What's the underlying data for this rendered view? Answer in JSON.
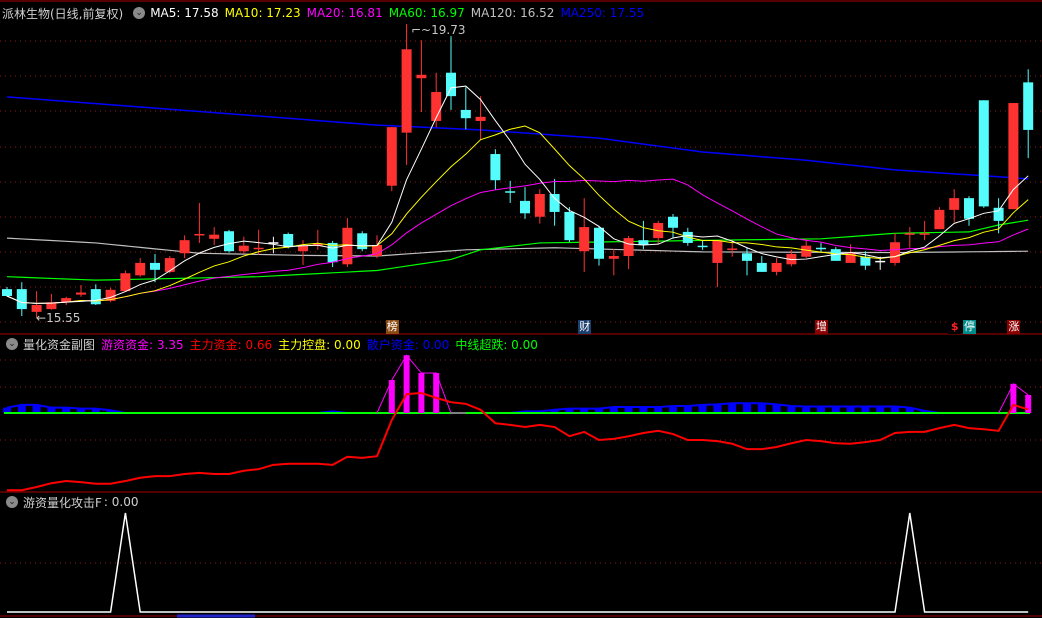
{
  "main": {
    "title": "派林生物(日线,前复权)",
    "ma": [
      {
        "label": "MA5: 17.58",
        "color": "#ffffff"
      },
      {
        "label": "MA10: 17.23",
        "color": "#ffff00"
      },
      {
        "label": "MA20: 16.81",
        "color": "#ff00ff"
      },
      {
        "label": "MA60: 16.97",
        "color": "#00ff00"
      },
      {
        "label": "MA120: 16.52",
        "color": "#c0c0c0"
      },
      {
        "label": "MA250: 17.55",
        "color": "#0000ff"
      }
    ],
    "high_label": "19.73",
    "low_label": "15.55",
    "markers": [
      {
        "text": "榜",
        "index": 26,
        "color": "#8b4a12"
      },
      {
        "text": "财",
        "index": 39,
        "color": "#1c3f6e"
      },
      {
        "text": "增",
        "index": 55,
        "color": "#8b0000"
      },
      {
        "text": "$",
        "index": 64,
        "color": "#000000"
      },
      {
        "text": "停",
        "index": 65,
        "color": "#008b8b"
      },
      {
        "text": "涨",
        "index": 68,
        "color": "#8b0000"
      }
    ]
  },
  "sub1": {
    "title": "量化资金副图",
    "items": [
      {
        "label": "游资资金: 3.35",
        "color": "#ff00ff"
      },
      {
        "label": "主力资金: 0.66",
        "color": "#ff0000"
      },
      {
        "label": "主力控盘: 0.00",
        "color": "#ffff00"
      },
      {
        "label": "散户资金: 0.00",
        "color": "#0000ff"
      },
      {
        "label": "中线超跌: 0.00",
        "color": "#00ff00"
      }
    ]
  },
  "sub2": {
    "title": "游资量化攻击F",
    "value": ": 0.00"
  },
  "chart_data": {
    "type": "candlestick",
    "candles": [
      [
        15.97,
        16.0,
        15.86,
        15.87
      ],
      [
        15.97,
        16.07,
        15.58,
        15.68
      ],
      [
        15.64,
        15.94,
        15.55,
        15.74
      ],
      [
        15.68,
        15.9,
        15.67,
        15.78
      ],
      [
        15.78,
        15.86,
        15.74,
        15.84
      ],
      [
        15.89,
        16.03,
        15.86,
        15.92
      ],
      [
        15.97,
        16.04,
        15.74,
        15.75
      ],
      [
        15.8,
        15.99,
        15.78,
        15.96
      ],
      [
        15.94,
        16.24,
        15.93,
        16.2
      ],
      [
        16.17,
        16.42,
        16.15,
        16.35
      ],
      [
        16.35,
        16.48,
        16.07,
        16.25
      ],
      [
        16.22,
        16.45,
        16.2,
        16.42
      ],
      [
        16.49,
        16.75,
        16.42,
        16.68
      ],
      [
        16.76,
        17.22,
        16.64,
        16.77
      ],
      [
        16.7,
        16.87,
        16.61,
        16.76
      ],
      [
        16.81,
        16.83,
        16.5,
        16.52
      ],
      [
        16.52,
        16.73,
        16.48,
        16.6
      ],
      [
        16.56,
        16.83,
        16.47,
        16.57
      ],
      [
        16.65,
        16.73,
        16.49,
        16.65
      ],
      [
        16.77,
        16.79,
        16.56,
        16.58
      ],
      [
        16.52,
        16.68,
        16.32,
        16.6
      ],
      [
        16.6,
        16.83,
        16.54,
        16.63
      ],
      [
        16.64,
        16.67,
        16.29,
        16.36
      ],
      [
        16.33,
        17.0,
        16.29,
        16.86
      ],
      [
        16.78,
        16.81,
        16.52,
        16.55
      ],
      [
        16.45,
        16.75,
        16.42,
        16.61
      ],
      [
        17.47,
        18.32,
        17.39,
        18.32
      ],
      [
        18.24,
        19.73,
        17.77,
        19.45
      ],
      [
        19.03,
        19.58,
        18.54,
        19.08
      ],
      [
        18.41,
        19.11,
        18.32,
        18.83
      ],
      [
        19.11,
        19.64,
        18.57,
        18.77
      ],
      [
        18.57,
        18.9,
        18.29,
        18.45
      ],
      [
        18.41,
        18.77,
        18.13,
        18.47
      ],
      [
        17.93,
        18.0,
        17.41,
        17.55
      ],
      [
        17.39,
        17.54,
        17.22,
        17.37
      ],
      [
        17.25,
        17.45,
        16.99,
        17.07
      ],
      [
        17.02,
        17.42,
        16.92,
        17.35
      ],
      [
        17.35,
        17.57,
        16.89,
        17.09
      ],
      [
        17.09,
        17.16,
        16.65,
        16.68
      ],
      [
        16.52,
        17.29,
        16.22,
        16.87
      ],
      [
        16.86,
        16.89,
        16.31,
        16.41
      ],
      [
        16.41,
        16.55,
        16.17,
        16.45
      ],
      [
        16.45,
        16.74,
        16.26,
        16.71
      ],
      [
        16.68,
        16.96,
        16.55,
        16.61
      ],
      [
        16.71,
        16.96,
        16.62,
        16.93
      ],
      [
        17.02,
        17.06,
        16.71,
        16.86
      ],
      [
        16.8,
        16.86,
        16.6,
        16.64
      ],
      [
        16.6,
        16.68,
        16.54,
        16.59
      ],
      [
        16.35,
        16.68,
        16.0,
        16.68
      ],
      [
        16.55,
        16.68,
        16.44,
        16.56
      ],
      [
        16.49,
        16.57,
        16.17,
        16.38
      ],
      [
        16.35,
        16.45,
        16.22,
        16.22
      ],
      [
        16.22,
        16.42,
        16.17,
        16.35
      ],
      [
        16.33,
        16.54,
        16.3,
        16.48
      ],
      [
        16.44,
        16.7,
        16.42,
        16.6
      ],
      [
        16.57,
        16.64,
        16.51,
        16.56
      ],
      [
        16.55,
        16.58,
        16.38,
        16.38
      ],
      [
        16.35,
        16.62,
        16.35,
        16.49
      ],
      [
        16.44,
        16.52,
        16.25,
        16.31
      ],
      [
        16.38,
        16.44,
        16.25,
        16.38
      ],
      [
        16.35,
        16.78,
        16.31,
        16.65
      ],
      [
        16.77,
        16.87,
        16.57,
        16.78
      ],
      [
        16.77,
        16.96,
        16.68,
        16.78
      ],
      [
        16.84,
        17.16,
        16.84,
        17.12
      ],
      [
        17.12,
        17.42,
        16.94,
        17.29
      ],
      [
        17.29,
        17.32,
        16.89,
        16.99
      ],
      [
        18.71,
        18.71,
        17.15,
        17.17
      ],
      [
        17.15,
        17.29,
        16.78,
        16.96
      ],
      [
        17.13,
        18.67,
        17.13,
        18.67
      ],
      [
        18.97,
        19.16,
        17.87,
        18.28
      ]
    ],
    "ma60": [
      [
        0,
        16.15
      ],
      [
        6,
        16.1
      ],
      [
        17,
        16.15
      ],
      [
        25,
        16.24
      ],
      [
        30,
        16.4
      ],
      [
        32,
        16.54
      ],
      [
        36,
        16.64
      ],
      [
        48,
        16.68
      ],
      [
        55,
        16.7
      ],
      [
        60,
        16.78
      ],
      [
        65,
        16.8
      ],
      [
        67,
        16.9
      ],
      [
        69,
        16.97
      ]
    ],
    "ma120": [
      [
        0,
        16.71
      ],
      [
        6,
        16.64
      ],
      [
        13,
        16.49
      ],
      [
        20,
        16.46
      ],
      [
        25,
        16.45
      ],
      [
        31,
        16.54
      ],
      [
        37,
        16.57
      ],
      [
        47,
        16.51
      ],
      [
        60,
        16.5
      ],
      [
        69,
        16.52
      ]
    ],
    "ma250": [
      [
        0,
        18.76
      ],
      [
        25,
        18.35
      ],
      [
        32,
        18.28
      ],
      [
        40,
        18.16
      ],
      [
        47,
        17.96
      ],
      [
        54,
        17.84
      ],
      [
        60,
        17.7
      ],
      [
        67,
        17.6
      ],
      [
        69,
        17.57
      ]
    ],
    "sub1_main": [
      -14.3,
      -14.3,
      -13.7,
      -13.0,
      -12.6,
      -12.8,
      -13.1,
      -13.1,
      -12.6,
      -12.0,
      -11.7,
      -11.7,
      -11.3,
      -11.1,
      -11.3,
      -11.3,
      -10.7,
      -10.4,
      -9.6,
      -9.4,
      -9.4,
      -9.4,
      -9.6,
      -8.1,
      -8.3,
      -8.0,
      -1.3,
      3.5,
      3.7,
      2.8,
      2.0,
      1.7,
      0.6,
      -1.9,
      -2.2,
      -2.6,
      -2.2,
      -2.6,
      -4.3,
      -3.5,
      -5.0,
      -4.8,
      -4.3,
      -3.7,
      -3.3,
      -3.9,
      -5.0,
      -5.0,
      -5.2,
      -5.7,
      -6.7,
      -6.7,
      -6.3,
      -5.6,
      -5.0,
      -5.2,
      -5.6,
      -5.7,
      -5.4,
      -5.0,
      -3.7,
      -3.5,
      -3.5,
      -2.8,
      -2.2,
      -2.8,
      -3.0,
      -3.3,
      1.5,
      0.66
    ],
    "sub1_hot": [
      0,
      0,
      0,
      0,
      0,
      0,
      0,
      0,
      0,
      0,
      0,
      0,
      0,
      0,
      0,
      0,
      0,
      0,
      0,
      0,
      0,
      0,
      0,
      0,
      0,
      0,
      6.1,
      10.7,
      7.4,
      7.4,
      0,
      0,
      0,
      0,
      0,
      0,
      0,
      0,
      0,
      0,
      0,
      0,
      0,
      0,
      0,
      0,
      0,
      0,
      0,
      0,
      0,
      0,
      0,
      0,
      0,
      0,
      0,
      0,
      0,
      0,
      0,
      0,
      0,
      0,
      0,
      0,
      0,
      0,
      5.4,
      3.35
    ],
    "sub1_retail": [
      1.0,
      1.5,
      1.5,
      1.0,
      1.0,
      0.8,
      0.8,
      0.5,
      0,
      0,
      0,
      0,
      0,
      0,
      0,
      0,
      0,
      0,
      0,
      0,
      0,
      0,
      0.3,
      0,
      0,
      0,
      0,
      0,
      0,
      0,
      0,
      0,
      0,
      0,
      0,
      0.3,
      0.3,
      0.6,
      0.8,
      0.8,
      0.8,
      1.1,
      1.1,
      1.1,
      1.1,
      1.3,
      1.3,
      1.5,
      1.6,
      1.8,
      1.8,
      1.8,
      1.6,
      1.3,
      1.2,
      1.2,
      1.2,
      1.2,
      1.2,
      1.2,
      1.2,
      1.0,
      0.4,
      0,
      0,
      0,
      0,
      0,
      0,
      0
    ],
    "sub2_signal": [
      0,
      0,
      0,
      0,
      0,
      0,
      0,
      0,
      1,
      0,
      0,
      0,
      0,
      0,
      0,
      0,
      0,
      0,
      0,
      0,
      0,
      0,
      0,
      0,
      0,
      0,
      0,
      0,
      0,
      0,
      0,
      0,
      0,
      0,
      0,
      0,
      0,
      0,
      0,
      0,
      0,
      0,
      0,
      0,
      0,
      0,
      0,
      0,
      0,
      0,
      0,
      0,
      0,
      0,
      0,
      0,
      0,
      0,
      0,
      0,
      0,
      1,
      0,
      0,
      0,
      0,
      0,
      0,
      0,
      0
    ]
  }
}
